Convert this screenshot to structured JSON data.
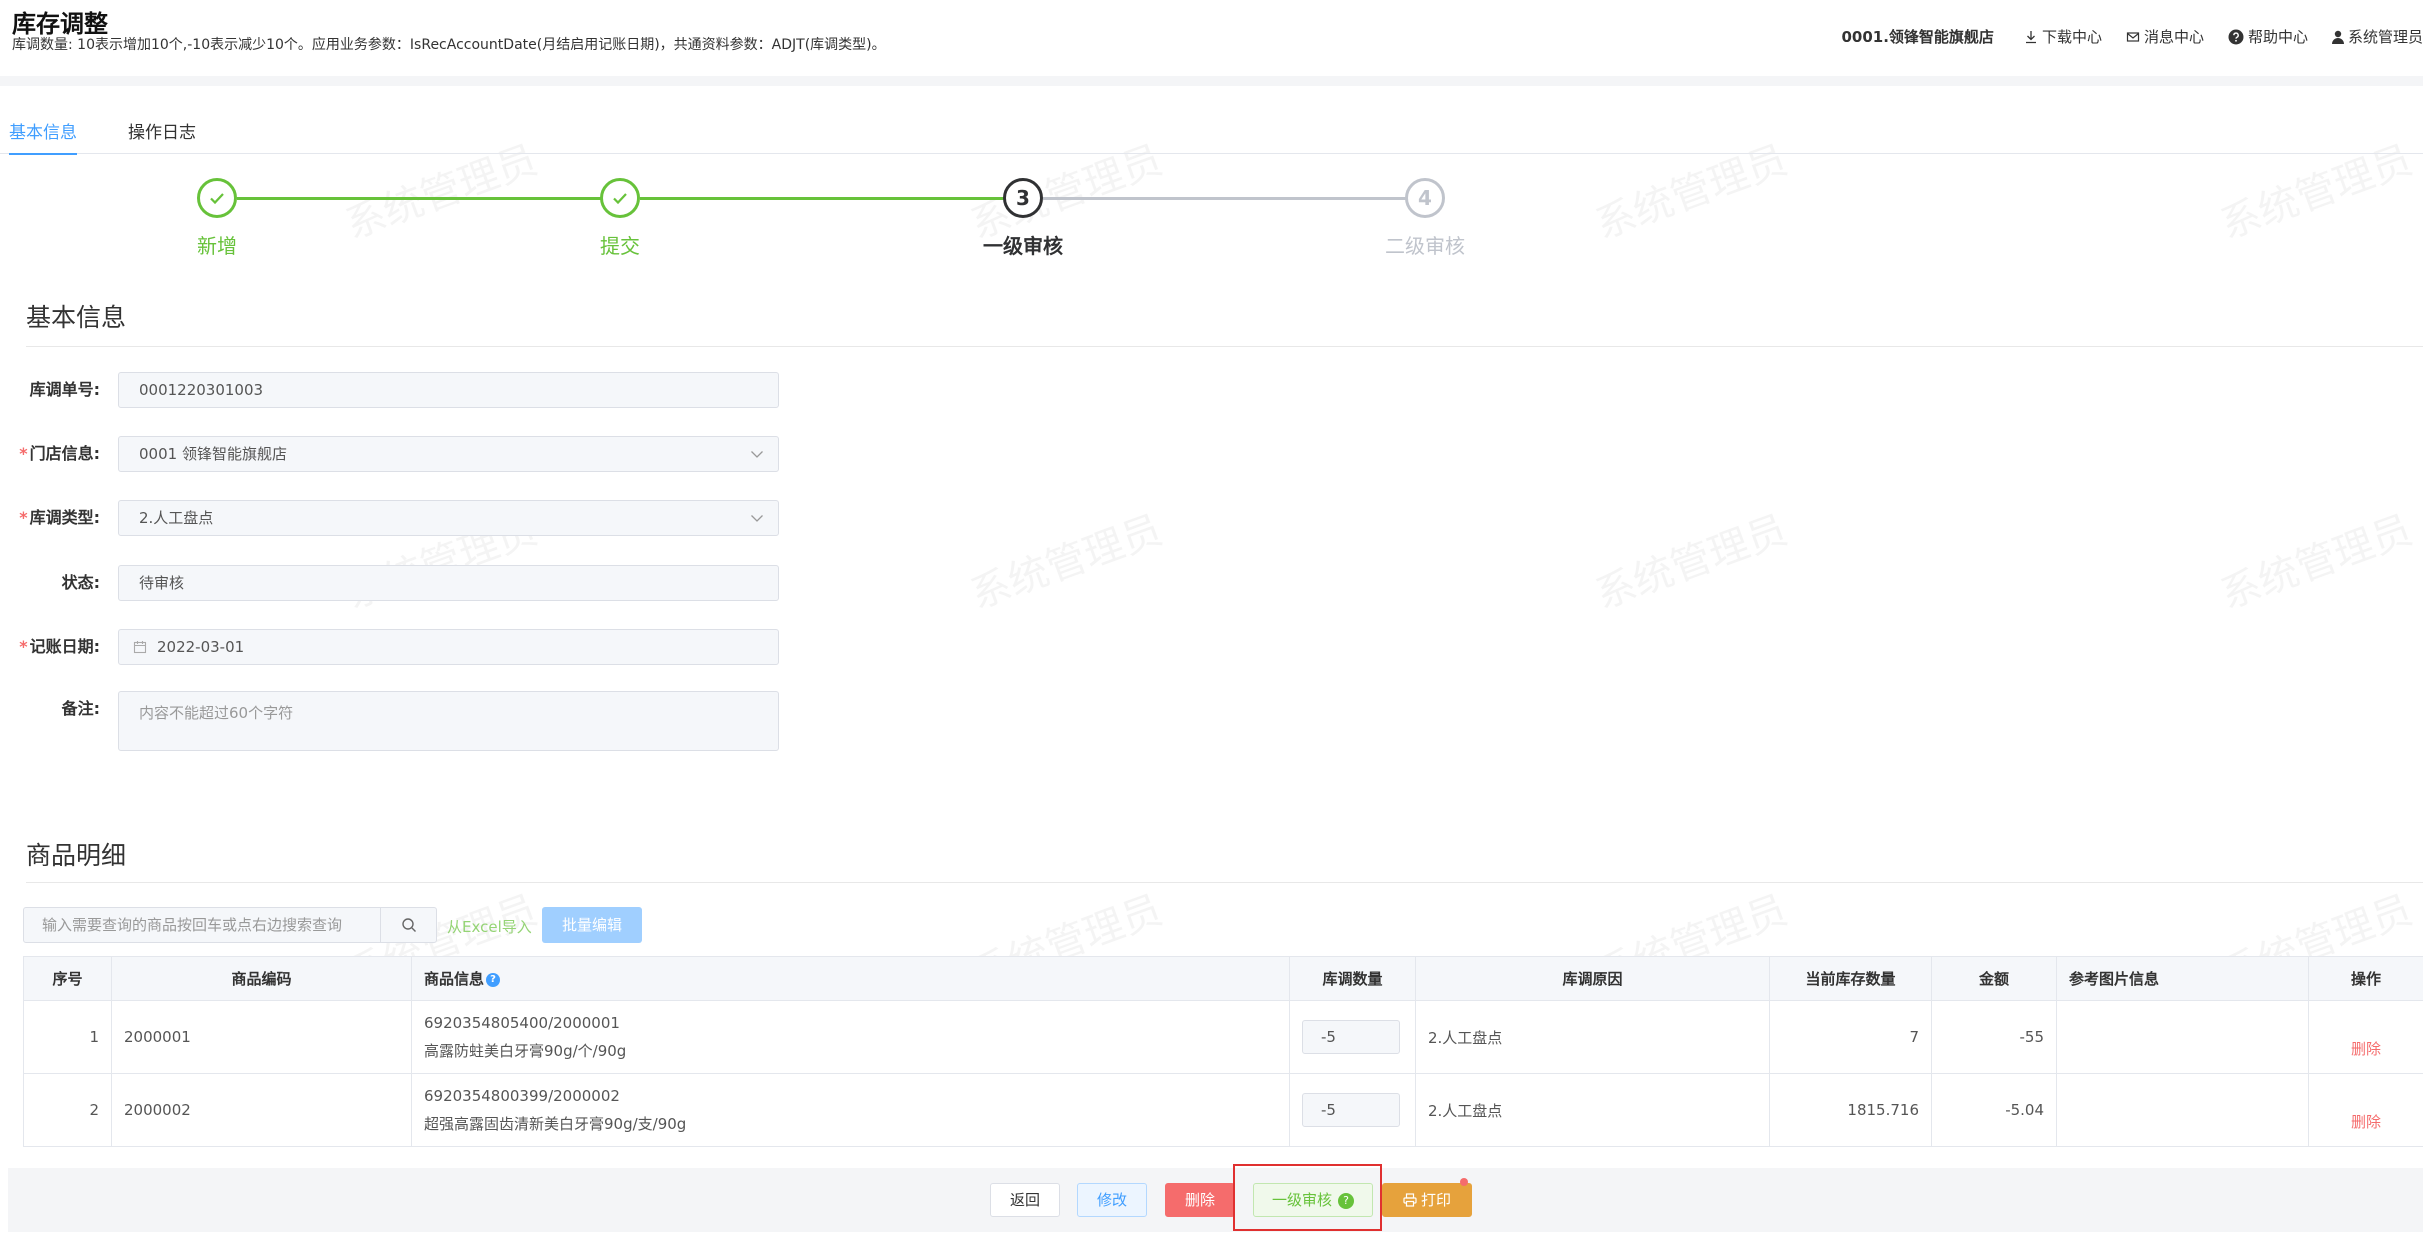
{
  "header": {
    "title": "库存调整",
    "description": "库调数量: 10表示增加10个,-10表示减少10个。应用业务参数：IsRecAccountDate(月结启用记账日期)，共通资料参数：ADJT(库调类型)。",
    "store": "0001.领锋智能旗舰店",
    "download": "下载中心",
    "messages": "消息中心",
    "help": "帮助中心",
    "user": "系统管理员"
  },
  "tabs": [
    {
      "label": "基本信息",
      "active": true
    },
    {
      "label": "操作日志",
      "active": false
    }
  ],
  "steps": [
    {
      "label": "新增",
      "status": "done"
    },
    {
      "label": "提交",
      "status": "done"
    },
    {
      "number": "3",
      "label": "一级审核",
      "status": "current"
    },
    {
      "number": "4",
      "label": "二级审核",
      "status": "pending"
    }
  ],
  "basic_info": {
    "title": "基本信息",
    "fields": {
      "order_no": {
        "label": "库调单号:",
        "value": "0001220301003"
      },
      "store": {
        "label": "门店信息:",
        "value": "0001 领锋智能旗舰店"
      },
      "adj_type": {
        "label": "库调类型:",
        "value": "2.人工盘点"
      },
      "status": {
        "label": "状态:",
        "value": "待审核"
      },
      "acc_date": {
        "label": "记账日期:",
        "value": "2022-03-01"
      },
      "remark": {
        "label": "备注:",
        "placeholder": "内容不能超过60个字符"
      }
    }
  },
  "product_detail": {
    "title": "商品明细",
    "search_placeholder": "输入需要查询的商品按回车或点右边搜索查询",
    "excel_import": "从Excel导入",
    "batch_edit": "批量编辑",
    "columns": [
      "序号",
      "商品编码",
      "商品信息",
      "库调数量",
      "库调原因",
      "当前库存数量",
      "金额",
      "参考图片信息",
      "操作"
    ],
    "rows": [
      {
        "seq": "1",
        "code": "2000001",
        "info_line1": "6920354805400/2000001",
        "info_line2": "高露防蛀美白牙膏90g/个/90g",
        "qty": "-5",
        "reason": "2.人工盘点",
        "stock": "7",
        "amount": "-55",
        "image": "",
        "action": "删除"
      },
      {
        "seq": "2",
        "code": "2000002",
        "info_line1": "6920354800399/2000002",
        "info_line2": "超强高露固齿清新美白牙膏90g/支/90g",
        "qty": "-5",
        "reason": "2.人工盘点",
        "stock": "1815.716",
        "amount": "-5.04",
        "image": "",
        "action": "删除"
      }
    ]
  },
  "footer": {
    "back": "返回",
    "edit": "修改",
    "delete": "删除",
    "audit": "一级审核",
    "print": "打印"
  },
  "watermark": "系统管理员",
  "colors": {
    "primary": "#409eff",
    "success": "#67c23a",
    "danger": "#f56c6c",
    "warning": "#e6a23c"
  }
}
